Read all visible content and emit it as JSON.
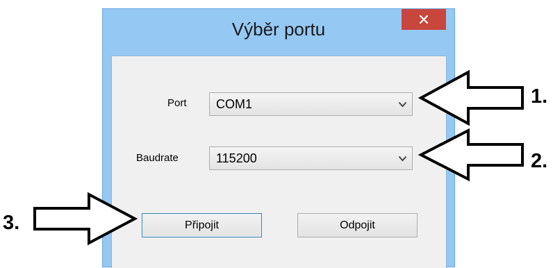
{
  "window": {
    "title": "Výběr portu",
    "close_icon": "close-icon"
  },
  "form": {
    "port_label": "Port",
    "port_value": "COM1",
    "baudrate_label": "Baudrate",
    "baudrate_value": "115200"
  },
  "buttons": {
    "connect_label": "Připojit",
    "disconnect_label": "Odpojit"
  },
  "annotations": {
    "step1": "1.",
    "step2": "2.",
    "step3": "3."
  },
  "colors": {
    "frame": "#96c8f4",
    "close": "#c9463d",
    "client": "#f0f0f0",
    "focus_border": "#3c7fb1"
  }
}
